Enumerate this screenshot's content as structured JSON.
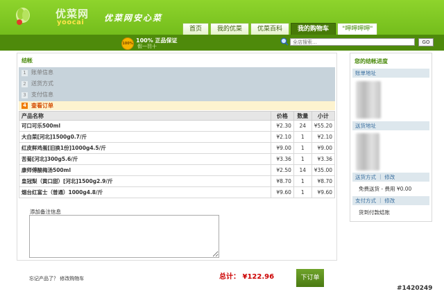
{
  "header": {
    "logo_cn": "优菜网",
    "logo_en": "yoocai",
    "slogan": "优菜网安心菜",
    "tabs": [
      "首页",
      "我的优菜",
      "优菜百科",
      "我的购物车",
      "\"呷呷呷呷\""
    ],
    "active_tab": "我的购物车"
  },
  "bar": {
    "badge_icon_text": "100%",
    "guarantee_title": "100% 正品保证",
    "guarantee_sub": "假一罚十",
    "search_placeholder": "全店搜索…",
    "go_label": "GO"
  },
  "main": {
    "title": "结帐",
    "steps": [
      {
        "num": "1",
        "label": "账单信息"
      },
      {
        "num": "2",
        "label": "送货方式"
      },
      {
        "num": "3",
        "label": "支付信息"
      }
    ],
    "current_step": {
      "num": "4",
      "label": "查看订单"
    },
    "columns": [
      "产品名称",
      "价格",
      "数量",
      "小计"
    ],
    "items": [
      {
        "name": "可口可乐500ml",
        "price": "¥2.30",
        "qty": "24",
        "subtotal": "¥55.20"
      },
      {
        "name": "大白菜[河北]1500g0.7/斤",
        "price": "¥2.10",
        "qty": "1",
        "subtotal": "¥2.10"
      },
      {
        "name": "红皮鲜鸡蛋[旧换1份]1000g4.5/斤",
        "price": "¥9.00",
        "qty": "1",
        "subtotal": "¥9.00"
      },
      {
        "name": "苦菊[河北]300g5.6/斤",
        "price": "¥3.36",
        "qty": "1",
        "subtotal": "¥3.36"
      },
      {
        "name": "康师傅酸梅汤500ml",
        "price": "¥2.50",
        "qty": "14",
        "subtotal": "¥35.00"
      },
      {
        "name": "皇冠梨（黄口甜）[河北]1500g2.9/斤",
        "price": "¥8.70",
        "qty": "1",
        "subtotal": "¥8.70"
      },
      {
        "name": "烟台红富士（普通）1000g4.8/斤",
        "price": "¥9.60",
        "qty": "1",
        "subtotal": "¥9.60"
      }
    ],
    "note_label": "添加备注信息",
    "forgot_text": "忘记产品了？ 修改购物车",
    "total_label": "总计：  ¥122.96",
    "order_button": "下订单"
  },
  "sidebar": {
    "title": "您的结帐进度",
    "billing_label": "账单地址",
    "shipping_label": "送货地址",
    "method_label": "送货方式 ｜ 修改",
    "method_value": "免费送货 - 费用 ¥0.00",
    "payment_label": "支付方式 ｜ 修改",
    "payment_value": "货到付款结账"
  },
  "watermark": "#1420249"
}
